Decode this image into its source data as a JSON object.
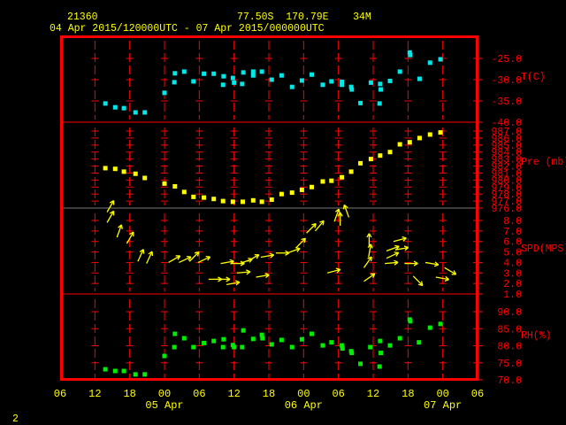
{
  "header": {
    "station_id": "21360",
    "location": "77.50S  170.79E    34M",
    "period": "04 Apr 2015/120000UTC - 07 Apr 2015/000000UTC"
  },
  "footer": {
    "page_number": "2"
  },
  "colors": {
    "frame": "#ff0000",
    "temperature": "#00e8e8",
    "pressure": "#ffff00",
    "wind": "#ffff00",
    "rh": "#00ee00",
    "text": "#ffff00"
  },
  "chart_data": {
    "type": "scatter",
    "title": "21360  77.50S 170.79E 34M  04 Apr 2015/120000UTC - 07 Apr 2015/000000UTC",
    "x_units": "hours since 04 Apr 2015 12UTC",
    "xlim": [
      -6,
      66
    ],
    "x_ticks": [
      "06",
      "12",
      "18",
      "00",
      "06",
      "12",
      "18",
      "00",
      "06",
      "12",
      "18",
      "00",
      "06"
    ],
    "x_day_labels": [
      {
        "label": "05 Apr",
        "at_hour": 12
      },
      {
        "label": "06 Apr",
        "at_hour": 36
      },
      {
        "label": "07 Apr",
        "at_hour": 60
      }
    ],
    "panels": [
      {
        "name": "temperature",
        "ylabel": "T(C)",
        "ylim": [
          -40,
          -25
        ],
        "tick_labels": [
          "-25.0",
          "-30.0",
          "-35.0",
          "-40.0"
        ],
        "tick_values": [
          -25,
          -30,
          -35,
          -40
        ],
        "points": [
          [
            1.8,
            -35.6
          ],
          [
            3.5,
            -36.5
          ],
          [
            5.0,
            -36.7
          ],
          [
            7.0,
            -37.7
          ],
          [
            8.6,
            -37.7
          ],
          [
            12.0,
            -33.1
          ],
          [
            13.7,
            -30.6
          ],
          [
            13.8,
            -28.5
          ],
          [
            15.4,
            -28.1
          ],
          [
            17.0,
            -30.4
          ],
          [
            18.8,
            -28.6
          ],
          [
            20.5,
            -28.6
          ],
          [
            22.1,
            -31.2
          ],
          [
            22.2,
            -29.2
          ],
          [
            23.8,
            -29.6
          ],
          [
            24.0,
            -30.7
          ],
          [
            25.4,
            -31.0
          ],
          [
            25.6,
            -28.3
          ],
          [
            27.3,
            -29.0
          ],
          [
            27.3,
            -28.1
          ],
          [
            28.8,
            -28.1
          ],
          [
            30.5,
            -30.0
          ],
          [
            32.2,
            -29.0
          ],
          [
            34.0,
            -31.7
          ],
          [
            35.7,
            -30.2
          ],
          [
            37.4,
            -28.8
          ],
          [
            39.3,
            -31.2
          ],
          [
            40.8,
            -30.4
          ],
          [
            42.6,
            -30.5
          ],
          [
            42.6,
            -31.2
          ],
          [
            44.2,
            -31.7
          ],
          [
            44.3,
            -32.3
          ],
          [
            45.8,
            -35.5
          ],
          [
            47.6,
            -30.7
          ],
          [
            49.2,
            -31.0
          ],
          [
            49.3,
            -32.3
          ],
          [
            49.1,
            -35.6
          ],
          [
            50.9,
            -30.3
          ],
          [
            52.6,
            -28.1
          ],
          [
            54.3,
            -23.6
          ],
          [
            54.4,
            -24.2
          ],
          [
            56.0,
            -29.8
          ],
          [
            57.8,
            -26.0
          ],
          [
            59.6,
            -25.2
          ]
        ]
      },
      {
        "name": "pressure",
        "ylabel": "Pre (mb)",
        "ylim": [
          976,
          987
        ],
        "tick_labels": [
          "987.0",
          "986.0",
          "985.0",
          "984.0",
          "983.0",
          "982.0",
          "981.0",
          "980.0",
          "979.0",
          "978.0",
          "977.0",
          "976.0"
        ],
        "tick_values": [
          987,
          986,
          985,
          984,
          983,
          982,
          981,
          980,
          979,
          978,
          977,
          976
        ],
        "points": [
          [
            1.8,
            981.7
          ],
          [
            3.5,
            981.6
          ],
          [
            5.0,
            981.2
          ],
          [
            7.0,
            980.9
          ],
          [
            8.6,
            980.3
          ],
          [
            12.0,
            979.5
          ],
          [
            13.8,
            979.1
          ],
          [
            15.4,
            978.3
          ],
          [
            17.0,
            977.6
          ],
          [
            18.8,
            977.5
          ],
          [
            20.5,
            977.3
          ],
          [
            22.1,
            977.0
          ],
          [
            23.8,
            976.9
          ],
          [
            25.5,
            976.9
          ],
          [
            27.3,
            977.1
          ],
          [
            28.8,
            976.9
          ],
          [
            30.5,
            977.2
          ],
          [
            32.2,
            978.0
          ],
          [
            34.0,
            978.2
          ],
          [
            35.7,
            978.6
          ],
          [
            37.4,
            979.0
          ],
          [
            39.3,
            979.8
          ],
          [
            40.8,
            979.9
          ],
          [
            42.6,
            980.4
          ],
          [
            44.2,
            981.2
          ],
          [
            45.8,
            982.4
          ],
          [
            47.6,
            983.0
          ],
          [
            49.2,
            983.5
          ],
          [
            50.9,
            984.0
          ],
          [
            52.6,
            985.1
          ],
          [
            54.3,
            985.4
          ],
          [
            56.0,
            986.0
          ],
          [
            57.8,
            986.5
          ],
          [
            59.6,
            986.8
          ]
        ]
      },
      {
        "name": "wind",
        "ylabel": "SPD(MPS)",
        "ylim": [
          1,
          8
        ],
        "tick_labels": [
          "8.0",
          "7.0",
          "6.0",
          "5.0",
          "4.0",
          "3.0",
          "2.0",
          "1.0"
        ],
        "tick_values": [
          8,
          7,
          6,
          5,
          4,
          3,
          2,
          1
        ],
        "point_format": "[hour, speed, arrow_angle_deg (0=right, 90=up)]",
        "points": [
          [
            2.1,
            8.8,
            60
          ],
          [
            2.1,
            7.8,
            60
          ],
          [
            3.8,
            6.4,
            70
          ],
          [
            5.5,
            5.8,
            60
          ],
          [
            7.4,
            4.1,
            65
          ],
          [
            8.9,
            3.9,
            65
          ],
          [
            12.7,
            4.0,
            30
          ],
          [
            14.5,
            4.0,
            25
          ],
          [
            16.3,
            4.1,
            45
          ],
          [
            17.8,
            4.0,
            25
          ],
          [
            19.6,
            2.4,
            0
          ],
          [
            21.0,
            2.4,
            0
          ],
          [
            22.7,
            1.9,
            10
          ],
          [
            21.7,
            3.9,
            10
          ],
          [
            23.5,
            3.9,
            0
          ],
          [
            24.5,
            3.0,
            5
          ],
          [
            25.0,
            3.9,
            20
          ],
          [
            26.3,
            4.1,
            30
          ],
          [
            27.8,
            2.6,
            10
          ],
          [
            28.6,
            4.5,
            10
          ],
          [
            31.2,
            4.9,
            0
          ],
          [
            33.2,
            4.9,
            20
          ],
          [
            34.7,
            5.4,
            45
          ],
          [
            36.5,
            6.8,
            45
          ],
          [
            38.0,
            7.0,
            50
          ],
          [
            40.1,
            3.0,
            15
          ],
          [
            41.3,
            7.9,
            70
          ],
          [
            42.3,
            7.5,
            90
          ],
          [
            43.8,
            8.3,
            110
          ],
          [
            46.4,
            2.2,
            35
          ],
          [
            46.4,
            3.5,
            55
          ],
          [
            47.2,
            4.5,
            80
          ],
          [
            47.3,
            5.5,
            90
          ],
          [
            50.0,
            3.9,
            5
          ],
          [
            50.3,
            4.4,
            25
          ],
          [
            50.3,
            5.1,
            20
          ],
          [
            51.8,
            5.2,
            10
          ],
          [
            51.5,
            6.0,
            15
          ],
          [
            53.4,
            3.9,
            0
          ],
          [
            54.9,
            2.7,
            -45
          ],
          [
            57.0,
            4.0,
            -10
          ],
          [
            58.8,
            2.6,
            -10
          ],
          [
            60.3,
            3.5,
            -30
          ]
        ]
      },
      {
        "name": "rh",
        "ylabel": "RH(%)",
        "ylim": [
          70,
          90
        ],
        "tick_labels": [
          "90.0",
          "85.0",
          "80.0",
          "75.0",
          "70.0"
        ],
        "tick_values": [
          90,
          85,
          80,
          75,
          70
        ],
        "points": [
          [
            1.8,
            73.1
          ],
          [
            3.5,
            72.6
          ],
          [
            5.0,
            72.6
          ],
          [
            7.0,
            71.6
          ],
          [
            8.6,
            71.6
          ],
          [
            12.0,
            77.0
          ],
          [
            13.7,
            79.6
          ],
          [
            13.8,
            83.5
          ],
          [
            15.4,
            82.2
          ],
          [
            17.0,
            79.6
          ],
          [
            18.8,
            80.8
          ],
          [
            20.5,
            81.4
          ],
          [
            22.2,
            81.9
          ],
          [
            22.1,
            79.6
          ],
          [
            23.8,
            80.2
          ],
          [
            24.0,
            79.6
          ],
          [
            25.4,
            79.6
          ],
          [
            25.6,
            84.5
          ],
          [
            27.3,
            82.0
          ],
          [
            28.8,
            83.2
          ],
          [
            28.9,
            82.2
          ],
          [
            30.5,
            80.4
          ],
          [
            32.2,
            81.7
          ],
          [
            34.0,
            79.6
          ],
          [
            35.7,
            81.9
          ],
          [
            37.4,
            83.5
          ],
          [
            39.3,
            80.1
          ],
          [
            40.8,
            81.0
          ],
          [
            42.6,
            80.1
          ],
          [
            42.7,
            79.2
          ],
          [
            44.2,
            78.4
          ],
          [
            44.3,
            77.9
          ],
          [
            45.8,
            74.7
          ],
          [
            47.5,
            79.6
          ],
          [
            49.2,
            81.4
          ],
          [
            49.3,
            77.9
          ],
          [
            49.1,
            73.9
          ],
          [
            50.9,
            80.1
          ],
          [
            52.6,
            82.2
          ],
          [
            54.3,
            87.7
          ],
          [
            54.4,
            87.2
          ],
          [
            55.9,
            81.0
          ],
          [
            57.8,
            85.3
          ],
          [
            59.6,
            86.4
          ]
        ]
      }
    ]
  }
}
